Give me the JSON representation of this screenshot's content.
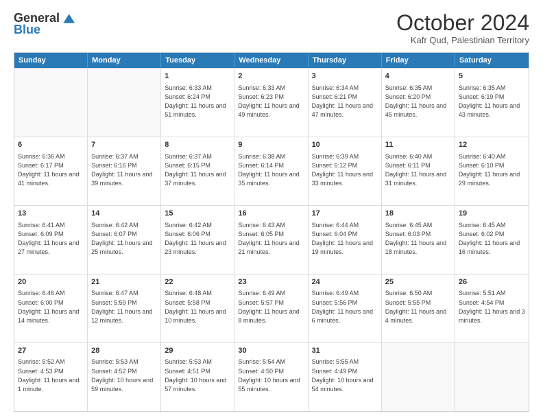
{
  "logo": {
    "general": "General",
    "blue": "Blue"
  },
  "title": "October 2024",
  "location": "Kafr Qud, Palestinian Territory",
  "days": [
    "Sunday",
    "Monday",
    "Tuesday",
    "Wednesday",
    "Thursday",
    "Friday",
    "Saturday"
  ],
  "weeks": [
    [
      {
        "day": "",
        "info": ""
      },
      {
        "day": "",
        "info": ""
      },
      {
        "day": "1",
        "info": "Sunrise: 6:33 AM\nSunset: 6:24 PM\nDaylight: 11 hours and 51 minutes."
      },
      {
        "day": "2",
        "info": "Sunrise: 6:33 AM\nSunset: 6:23 PM\nDaylight: 11 hours and 49 minutes."
      },
      {
        "day": "3",
        "info": "Sunrise: 6:34 AM\nSunset: 6:21 PM\nDaylight: 11 hours and 47 minutes."
      },
      {
        "day": "4",
        "info": "Sunrise: 6:35 AM\nSunset: 6:20 PM\nDaylight: 11 hours and 45 minutes."
      },
      {
        "day": "5",
        "info": "Sunrise: 6:35 AM\nSunset: 6:19 PM\nDaylight: 11 hours and 43 minutes."
      }
    ],
    [
      {
        "day": "6",
        "info": "Sunrise: 6:36 AM\nSunset: 6:17 PM\nDaylight: 11 hours and 41 minutes."
      },
      {
        "day": "7",
        "info": "Sunrise: 6:37 AM\nSunset: 6:16 PM\nDaylight: 11 hours and 39 minutes."
      },
      {
        "day": "8",
        "info": "Sunrise: 6:37 AM\nSunset: 6:15 PM\nDaylight: 11 hours and 37 minutes."
      },
      {
        "day": "9",
        "info": "Sunrise: 6:38 AM\nSunset: 6:14 PM\nDaylight: 11 hours and 35 minutes."
      },
      {
        "day": "10",
        "info": "Sunrise: 6:39 AM\nSunset: 6:12 PM\nDaylight: 11 hours and 33 minutes."
      },
      {
        "day": "11",
        "info": "Sunrise: 6:40 AM\nSunset: 6:11 PM\nDaylight: 11 hours and 31 minutes."
      },
      {
        "day": "12",
        "info": "Sunrise: 6:40 AM\nSunset: 6:10 PM\nDaylight: 11 hours and 29 minutes."
      }
    ],
    [
      {
        "day": "13",
        "info": "Sunrise: 6:41 AM\nSunset: 6:09 PM\nDaylight: 11 hours and 27 minutes."
      },
      {
        "day": "14",
        "info": "Sunrise: 6:42 AM\nSunset: 6:07 PM\nDaylight: 11 hours and 25 minutes."
      },
      {
        "day": "15",
        "info": "Sunrise: 6:42 AM\nSunset: 6:06 PM\nDaylight: 11 hours and 23 minutes."
      },
      {
        "day": "16",
        "info": "Sunrise: 6:43 AM\nSunset: 6:05 PM\nDaylight: 11 hours and 21 minutes."
      },
      {
        "day": "17",
        "info": "Sunrise: 6:44 AM\nSunset: 6:04 PM\nDaylight: 11 hours and 19 minutes."
      },
      {
        "day": "18",
        "info": "Sunrise: 6:45 AM\nSunset: 6:03 PM\nDaylight: 11 hours and 18 minutes."
      },
      {
        "day": "19",
        "info": "Sunrise: 6:45 AM\nSunset: 6:02 PM\nDaylight: 11 hours and 16 minutes."
      }
    ],
    [
      {
        "day": "20",
        "info": "Sunrise: 6:46 AM\nSunset: 6:00 PM\nDaylight: 11 hours and 14 minutes."
      },
      {
        "day": "21",
        "info": "Sunrise: 6:47 AM\nSunset: 5:59 PM\nDaylight: 11 hours and 12 minutes."
      },
      {
        "day": "22",
        "info": "Sunrise: 6:48 AM\nSunset: 5:58 PM\nDaylight: 11 hours and 10 minutes."
      },
      {
        "day": "23",
        "info": "Sunrise: 6:49 AM\nSunset: 5:57 PM\nDaylight: 11 hours and 8 minutes."
      },
      {
        "day": "24",
        "info": "Sunrise: 6:49 AM\nSunset: 5:56 PM\nDaylight: 11 hours and 6 minutes."
      },
      {
        "day": "25",
        "info": "Sunrise: 6:50 AM\nSunset: 5:55 PM\nDaylight: 11 hours and 4 minutes."
      },
      {
        "day": "26",
        "info": "Sunrise: 5:51 AM\nSunset: 4:54 PM\nDaylight: 11 hours and 3 minutes."
      }
    ],
    [
      {
        "day": "27",
        "info": "Sunrise: 5:52 AM\nSunset: 4:53 PM\nDaylight: 11 hours and 1 minute."
      },
      {
        "day": "28",
        "info": "Sunrise: 5:53 AM\nSunset: 4:52 PM\nDaylight: 10 hours and 59 minutes."
      },
      {
        "day": "29",
        "info": "Sunrise: 5:53 AM\nSunset: 4:51 PM\nDaylight: 10 hours and 57 minutes."
      },
      {
        "day": "30",
        "info": "Sunrise: 5:54 AM\nSunset: 4:50 PM\nDaylight: 10 hours and 55 minutes."
      },
      {
        "day": "31",
        "info": "Sunrise: 5:55 AM\nSunset: 4:49 PM\nDaylight: 10 hours and 54 minutes."
      },
      {
        "day": "",
        "info": ""
      },
      {
        "day": "",
        "info": ""
      }
    ]
  ]
}
